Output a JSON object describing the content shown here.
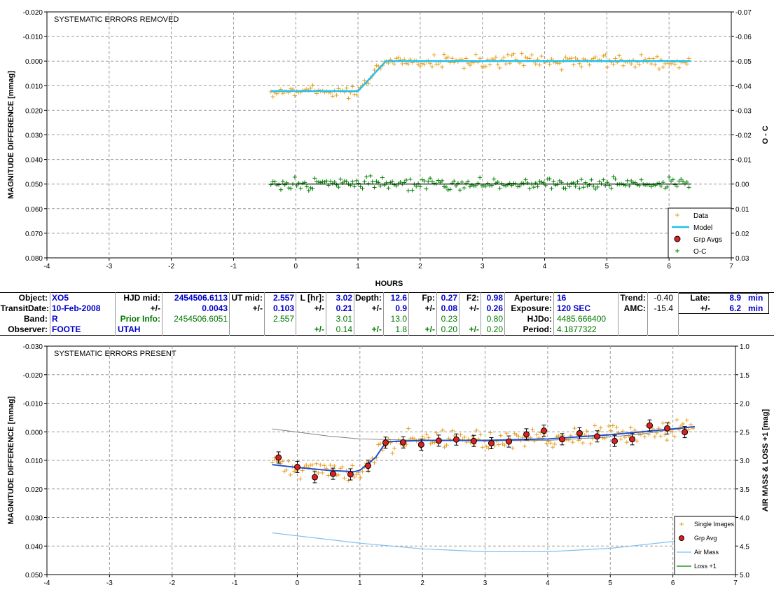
{
  "chart_data": [
    {
      "type": "scatter",
      "title": "SYSTEMATIC ERRORS REMOVED",
      "xlabel": "HOURS",
      "ylabel": "MAGNITUDE DIFFERENCE [mmag]",
      "y2label": "O - C",
      "xlim": [
        -4,
        7
      ],
      "ylim": [
        -0.02,
        0.08
      ],
      "y2lim": [
        -0.07,
        0.03
      ],
      "x_ticks": [
        "-4",
        "-3",
        "-2",
        "-1",
        "0",
        "1",
        "2",
        "3",
        "4",
        "5",
        "6",
        "7"
      ],
      "y_ticks": [
        "-0.020",
        "-0.010",
        "0.000",
        "0.010",
        "0.020",
        "0.030",
        "0.040",
        "0.050",
        "0.060",
        "0.070",
        "0.080"
      ],
      "y2_ticks": [
        "-0.07",
        "-0.06",
        "-0.05",
        "-0.04",
        "-0.03",
        "-0.02",
        "-0.01",
        "0.00",
        "0.01",
        "0.02",
        "0.03"
      ],
      "grid": true,
      "legend_position": "bottom-right",
      "series": [
        {
          "name": "Data",
          "color": "#e8a020",
          "style": "plus",
          "x_range": [
            -0.4,
            6.35
          ],
          "trend": "model",
          "scatter": 0.004
        },
        {
          "name": "Model",
          "color": "#20c0f0",
          "style": "line",
          "x": [
            -0.4,
            1.0,
            1.45,
            6.35
          ],
          "y": [
            0.0122,
            0.0122,
            0.0,
            0.0
          ]
        },
        {
          "name": "Grp Avgs",
          "color": "#e02020",
          "style": "dot",
          "values": []
        },
        {
          "name": "O-C",
          "color": "#008000",
          "style": "plus",
          "x_range": [
            -0.4,
            6.35
          ],
          "level": 0.05,
          "scatter": 0.0035
        }
      ],
      "reference_line": {
        "x": [
          -0.4,
          6.35
        ],
        "y": 0.05,
        "color": "#000000"
      }
    },
    {
      "type": "scatter",
      "title": "SYSTEMATIC ERRORS PRESENT",
      "xlabel": "",
      "ylabel": "MAGNITUDE DIFFERENCE [mmag]",
      "y2label": "AIR MASS & LOSS +1 [mag]",
      "xlim": [
        -4,
        7
      ],
      "ylim": [
        -0.03,
        0.05
      ],
      "y2lim": [
        1.0,
        5.0
      ],
      "x_ticks": [
        "-4",
        "-3",
        "-2",
        "-1",
        "0",
        "1",
        "2",
        "3",
        "4",
        "5",
        "6",
        "7"
      ],
      "y_ticks": [
        "-0.030",
        "-0.020",
        "-0.010",
        "0.000",
        "0.010",
        "0.020",
        "0.030",
        "0.040",
        "0.050"
      ],
      "y2_ticks": [
        "1.0",
        "1.5",
        "2.0",
        "2.5",
        "3.0",
        "3.5",
        "4.0",
        "4.5",
        "5.0"
      ],
      "grid": true,
      "legend_position": "bottom-right",
      "series": [
        {
          "name": "Single Images",
          "color": "#e8a020",
          "style": "plus",
          "x_range": [
            -0.4,
            6.35
          ],
          "scatter": 0.005
        },
        {
          "name": "Grp Avg",
          "color": "#e02020",
          "style": "dot",
          "x": [
            -0.3,
            0.0,
            0.28,
            0.57,
            0.85,
            1.13,
            1.41,
            1.69,
            1.98,
            2.26,
            2.54,
            2.82,
            3.1,
            3.38,
            3.66,
            3.94,
            4.23,
            4.51,
            4.79,
            5.07,
            5.35,
            5.63,
            5.91,
            6.19
          ],
          "y": [
            0.009,
            0.0123,
            0.0159,
            0.0147,
            0.0149,
            0.0119,
            0.0038,
            0.0037,
            0.0045,
            0.0031,
            0.0027,
            0.0032,
            0.004,
            0.0034,
            0.0009,
            -0.0004,
            0.0026,
            0.0005,
            0.0016,
            0.0032,
            0.0026,
            -0.0022,
            -0.0012,
            0.0001
          ]
        },
        {
          "name": "Air Mass",
          "color": "#80c0f0",
          "style": "line",
          "x": [
            -0.4,
            1.0,
            2.0,
            3.0,
            4.0,
            5.0,
            6.0,
            6.35
          ],
          "y": [
            1.73,
            1.55,
            1.45,
            1.4,
            1.4,
            1.46,
            1.58,
            1.65
          ]
        },
        {
          "name": "Loss +1",
          "color": "#008000",
          "style": "line",
          "values": []
        }
      ],
      "model_line": {
        "color": "#2050d0",
        "x": [
          -0.4,
          0.0,
          0.5,
          0.9,
          1.0,
          1.25,
          1.42,
          2.0,
          3.0,
          4.0,
          5.0,
          6.0,
          6.35
        ],
        "y": [
          0.0115,
          0.0125,
          0.0135,
          0.014,
          0.0135,
          0.009,
          0.0035,
          0.003,
          0.003,
          0.0025,
          0.001,
          -0.001,
          -0.0018
        ]
      },
      "gray_line": {
        "color": "#808080",
        "x": [
          -0.4,
          0.5,
          1.0,
          2.0,
          3.0,
          4.0,
          5.0,
          5.5,
          6.0,
          6.35
        ],
        "y": [
          -0.001,
          0.0015,
          0.0025,
          0.003,
          0.0032,
          0.003,
          0.0018,
          0.0008,
          -0.0008,
          -0.0018
        ]
      }
    }
  ],
  "info_table": {
    "object_label": "Object:",
    "object": "XO5",
    "hjd_mid_label": "HJD mid:",
    "hjd_mid": "2454506.6113",
    "ut_mid_label": "UT mid:",
    "ut_mid": "2.557",
    "l_hr_label": "L [hr]:",
    "l_hr": "3.02",
    "depth_label": "Depth:",
    "depth": "12.6",
    "fp_label": "Fp:",
    "fp": "0.27",
    "f2_label": "F2:",
    "f2": "0.98",
    "aperture_label": "Aperture:",
    "aperture": "16",
    "trend_label": "Trend:",
    "trend": "-0.40",
    "late_label": "Late:",
    "late": "8.9",
    "late_unit": "min",
    "transit_date_label": "TransitDate:",
    "transit_date": "10-Feb-2008",
    "pm": "+/-",
    "hjd_err": "0.0043",
    "ut_err": "0.103",
    "l_err": "0.21",
    "depth_err": "0.9",
    "fp_err": "0.08",
    "f2_err": "0.26",
    "exposure_label": "Exposure:",
    "exposure": "120 SEC",
    "amc_label": "AMC:",
    "amc": "-15.4",
    "late_err": "6.2",
    "late_err_unit": "min",
    "band_label": "Band:",
    "band": "R",
    "prior_info_label": "Prior Info:",
    "prior_hjd": "2454506.6051",
    "prior_ut": "2.557",
    "prior_l": "3.01",
    "prior_depth": "13.0",
    "prior_fp": "0.23",
    "prior_f2": "0.80",
    "hjdo_label": "HJDo:",
    "hjdo": "4485.666400",
    "observer_label": "Observer:",
    "observer": "FOOTE",
    "site": "UTAH",
    "prior_l_err": "0.14",
    "prior_depth_err": "1.8",
    "prior_fp_err": "0.20",
    "prior_f2_err": "0.20",
    "period_label": "Period:",
    "period": "4.1877322"
  }
}
